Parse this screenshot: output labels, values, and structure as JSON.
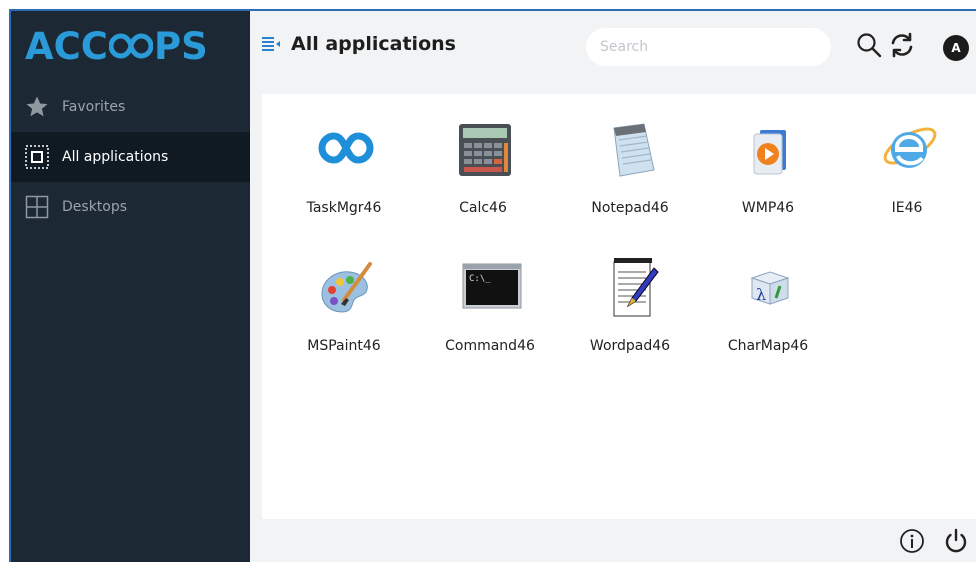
{
  "brand": {
    "logo_text_left": "ACC",
    "logo_text_right": "PS",
    "color": "#2a9bd8"
  },
  "sidebar": {
    "items": [
      {
        "label": "Favorites",
        "icon": "star-icon"
      },
      {
        "label": "All applications",
        "icon": "apps-grid-icon",
        "active": true
      },
      {
        "label": "Desktops",
        "icon": "desktops-grid-icon"
      }
    ]
  },
  "header": {
    "title": "All applications",
    "search": {
      "placeholder": "Search",
      "value": ""
    },
    "avatar_initial": "A"
  },
  "apps": [
    {
      "label": "TaskMgr46",
      "icon": "taskmgr-icon"
    },
    {
      "label": "Calc46",
      "icon": "calculator-icon"
    },
    {
      "label": "Notepad46",
      "icon": "notepad-icon"
    },
    {
      "label": "WMP46",
      "icon": "media-player-icon"
    },
    {
      "label": "IE46",
      "icon": "internet-explorer-icon"
    },
    {
      "label": "MSPaint46",
      "icon": "paint-palette-icon"
    },
    {
      "label": "Command46",
      "icon": "command-prompt-icon"
    },
    {
      "label": "Wordpad46",
      "icon": "wordpad-icon"
    },
    {
      "label": "CharMap46",
      "icon": "charmap-icon"
    }
  ],
  "command_icon_text": "C:\\_",
  "charmap_icon_text": "λ",
  "colors": {
    "sidebar": "#1c2833",
    "sidebar_active": "#101a23",
    "accent": "#2a9bd8",
    "frame": "#2e6db4"
  }
}
